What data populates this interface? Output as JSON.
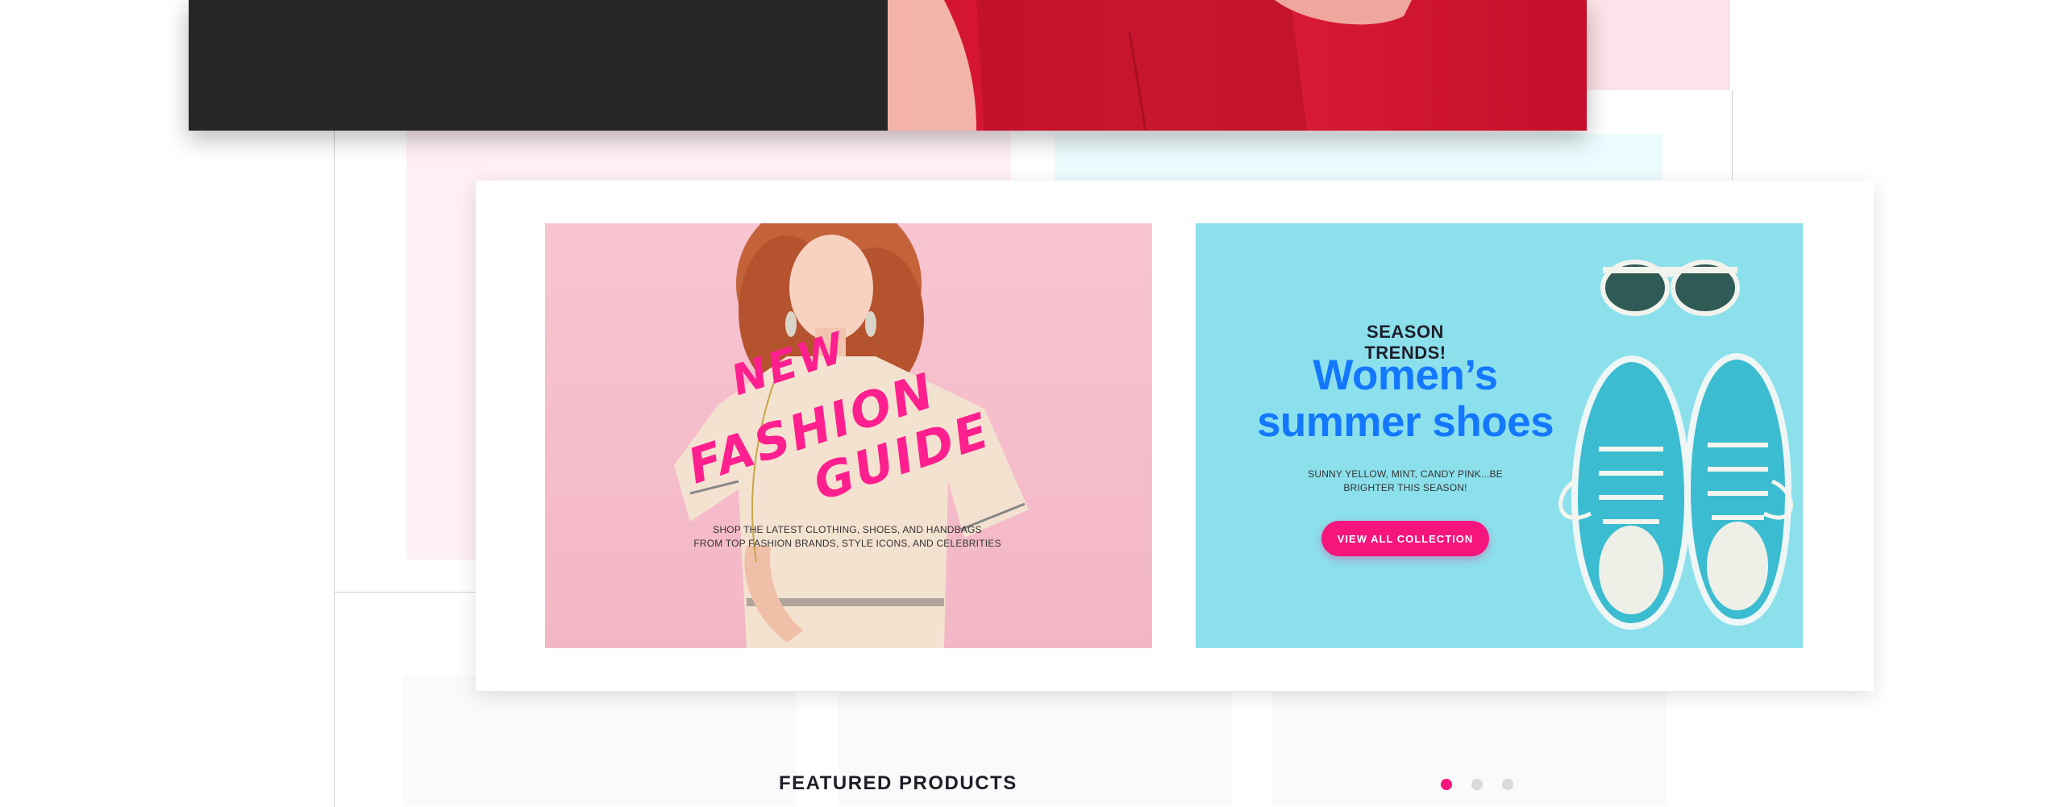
{
  "promo_left": {
    "title_lines": [
      "NEW",
      "FASHION",
      "GUIDE"
    ],
    "description_lines": [
      "SHOP THE LATEST CLOTHING, SHOES, AND HANDBAGS",
      "FROM TOP FASHION BRANDS, STYLE ICONS, AND CELEBRITIES"
    ]
  },
  "promo_right": {
    "eyebrow": "SEASON TRENDS!",
    "headline_lines": [
      "Women’s",
      "summer shoes"
    ],
    "description_lines": [
      "SUNNY YELLOW, MINT, CANDY PINK...BE",
      "BRIGHTER THIS SEASON!"
    ],
    "cta_label": "VIEW ALL COLLECTION"
  },
  "featured": {
    "title": "FEATURED PRODUCTS",
    "carousel_dots": 3,
    "active_dot": 1
  },
  "colors": {
    "accent_pink": "#f5157d",
    "headline_blue": "#1477ff",
    "panel_pink": "#f8c5d1",
    "panel_cyan": "#8be0ec",
    "dark": "#262626",
    "red": "#d1122c"
  },
  "icons": [
    "carousel-dot-icon"
  ]
}
